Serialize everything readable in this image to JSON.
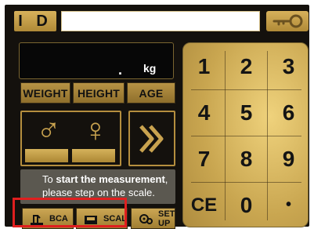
{
  "header": {
    "id_label": "I D",
    "id_input_value": "",
    "key_icon": "key-icon"
  },
  "display": {
    "decimal": ".",
    "unit": "kg"
  },
  "tabs": {
    "weight": "WEIGHT",
    "height": "HEIGHT",
    "age": "AGE"
  },
  "gender": {
    "male_icon": "male-icon",
    "female_icon": "female-icon"
  },
  "next": {
    "icon": "double-chevron-right-icon"
  },
  "message": {
    "prefix": "To ",
    "bold": "start the measurement",
    "suffix": ",",
    "line2": "please step on the scale."
  },
  "bottom_buttons": {
    "bca": "BCA",
    "scale": "SCALE",
    "setup": "SET UP"
  },
  "keypad": {
    "keys": [
      "1",
      "2",
      "3",
      "4",
      "5",
      "6",
      "7",
      "8",
      "9",
      "CE",
      "0",
      "•"
    ]
  },
  "colors": {
    "gold": "#c9a34f",
    "highlight_red": "#e01f1f",
    "panel_dark": "#14110d"
  }
}
